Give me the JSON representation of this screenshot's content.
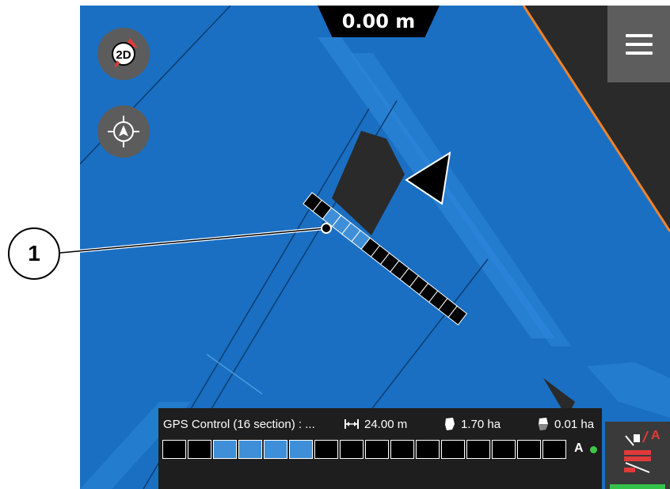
{
  "header": {
    "distance": "0.00 m"
  },
  "map_controls": {
    "view_mode_label": "2D"
  },
  "menu": {
    "icon": "hamburger-menu-icon"
  },
  "status_bar": {
    "mode_text": "GPS Control (16 section) : ...",
    "working_width": "24.00 m",
    "total_area": "1.70 ha",
    "partial_area": "0.01 ha",
    "section_states": [
      false,
      false,
      true,
      true,
      true,
      true,
      false,
      false,
      false,
      false,
      false,
      false,
      false,
      false,
      false,
      false
    ],
    "mode_letter": "A",
    "mode_status_color": "#3ec84a"
  },
  "auto_button": {
    "label": "A",
    "active_color": "#35c24a"
  },
  "callout": {
    "number": "1"
  },
  "colors": {
    "field": "#1a6fc2",
    "worked_area": "#2d86d9",
    "boundary": "#f0832a",
    "uncovered": "#2a2a2a"
  }
}
